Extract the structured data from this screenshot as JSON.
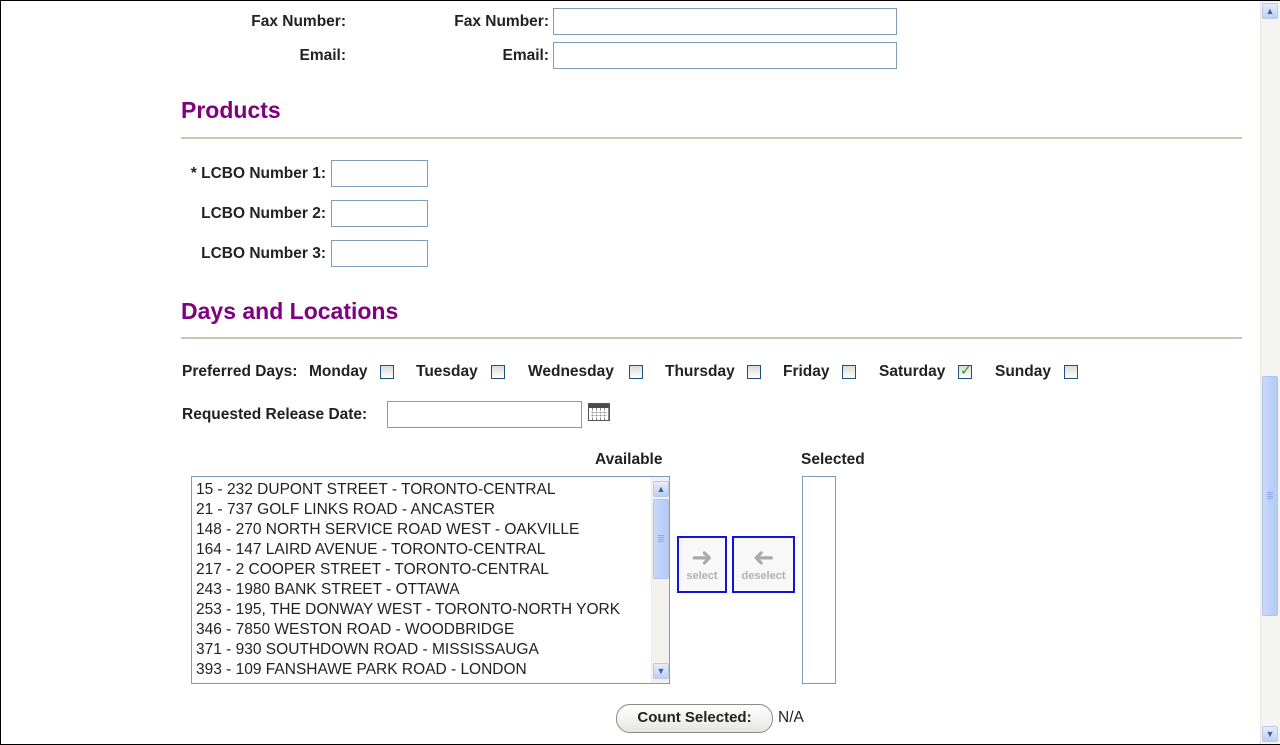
{
  "contact": {
    "fax_left": "Fax Number:",
    "fax_right": "Fax Number:",
    "email_left": "Email:",
    "email_right": "Email:"
  },
  "products": {
    "heading": "Products",
    "lcbo1_label": "* LCBO Number 1:",
    "lcbo2_label": "LCBO Number 2:",
    "lcbo3_label": "LCBO Number 3:"
  },
  "days_locations": {
    "heading": "Days and Locations",
    "preferred_days_label": "Preferred Days:",
    "days": [
      {
        "label": "Monday",
        "checked": false
      },
      {
        "label": "Tuesday",
        "checked": false
      },
      {
        "label": "Wednesday",
        "checked": false
      },
      {
        "label": "Thursday",
        "checked": false
      },
      {
        "label": "Friday",
        "checked": false
      },
      {
        "label": "Saturday",
        "checked": true
      },
      {
        "label": "Sunday",
        "checked": false
      }
    ],
    "release_date_label": "Requested Release Date:",
    "available_label": "Available",
    "selected_label": "Selected",
    "available_locations": [
      "15 - 232 DUPONT STREET - TORONTO-CENTRAL",
      "21 - 737 GOLF LINKS ROAD - ANCASTER",
      "148 - 270 NORTH SERVICE ROAD WEST - OAKVILLE",
      "164 - 147 LAIRD AVENUE - TORONTO-CENTRAL",
      "217 - 2 COOPER STREET - TORONTO-CENTRAL",
      "243 - 1980 BANK STREET - OTTAWA",
      "253 - 195, THE DONWAY WEST - TORONTO-NORTH YORK",
      "346 - 7850 WESTON ROAD - WOODBRIDGE",
      "371 - 930 SOUTHDOWN ROAD - MISSISSAUGA",
      "393 - 109 FANSHAWE PARK ROAD - LONDON"
    ],
    "select_button": "select",
    "deselect_button": "deselect",
    "count_button": "Count Selected:",
    "count_value": "N/A"
  },
  "icons": {
    "calendar": "calendar-icon",
    "select_arrow": "arrow-right-icon",
    "deselect_arrow": "arrow-left-icon"
  },
  "colors": {
    "section_heading": "#800080",
    "button_border": "#1212d8",
    "rule": "#c8c7a8"
  }
}
